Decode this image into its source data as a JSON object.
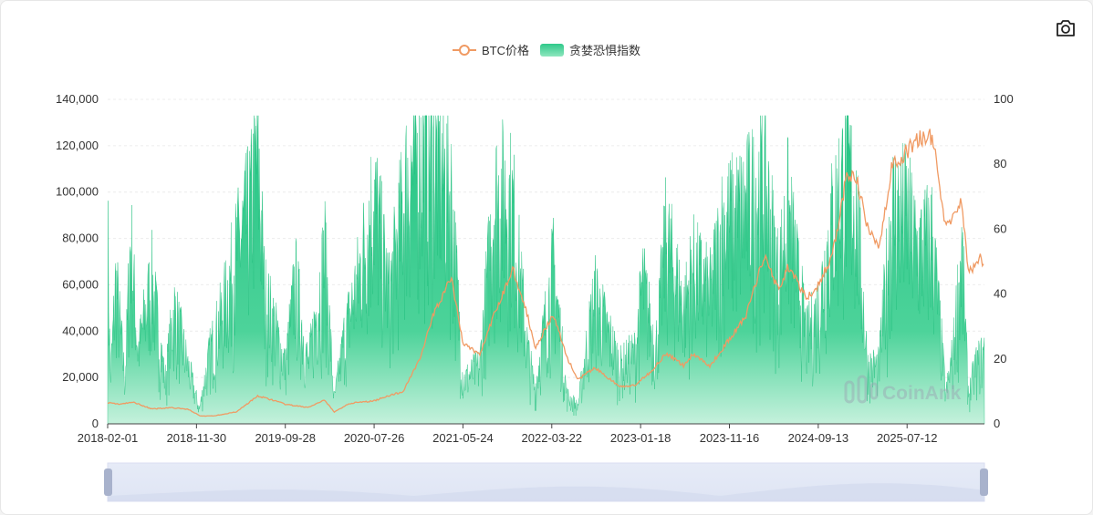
{
  "toolbar": {
    "camera_icon": "camera-icon"
  },
  "legend": {
    "btc": {
      "label": "BTC价格",
      "color": "#f09a63"
    },
    "fear": {
      "label": "贪婪恐惧指数",
      "color": "#2fc98a"
    }
  },
  "watermark": {
    "text": "CoinAnk"
  },
  "chart_data": {
    "type": "line",
    "x_axis": {
      "type": "date",
      "range": [
        "2018-02-01",
        "2026-04-01"
      ],
      "tick_labels": [
        "2018-02-01",
        "2018-11-30",
        "2019-09-28",
        "2020-07-26",
        "2021-05-24",
        "2022-03-22",
        "2023-01-18",
        "2023-11-16",
        "2024-09-13",
        "2025-07-12"
      ]
    },
    "y_axis_left": {
      "range": [
        0,
        140000
      ],
      "ticks": [
        0,
        20000,
        40000,
        60000,
        80000,
        100000,
        120000,
        140000
      ],
      "tick_labels": [
        "0",
        "20,000",
        "40,000",
        "60,000",
        "80,000",
        "100,000",
        "120,000",
        "140,000"
      ]
    },
    "y_axis_right": {
      "range": [
        0,
        100
      ],
      "ticks": [
        0,
        20,
        40,
        60,
        80,
        100
      ],
      "tick_labels": [
        "0",
        "20",
        "40",
        "60",
        "80",
        "100"
      ]
    },
    "grid": "horizontal",
    "legend_position": "top-center",
    "series": [
      {
        "name": "BTC价格",
        "type": "line",
        "axis": "left",
        "color": "#f09a63",
        "points": [
          [
            "2018-02-01",
            9200
          ],
          [
            "2018-03-15",
            8500
          ],
          [
            "2018-05-01",
            9300
          ],
          [
            "2018-07-01",
            6400
          ],
          [
            "2018-09-01",
            7000
          ],
          [
            "2018-11-01",
            6300
          ],
          [
            "2018-12-15",
            3300
          ],
          [
            "2019-02-01",
            3500
          ],
          [
            "2019-04-15",
            5200
          ],
          [
            "2019-06-26",
            12000
          ],
          [
            "2019-08-15",
            10300
          ],
          [
            "2019-10-01",
            8300
          ],
          [
            "2019-12-15",
            7100
          ],
          [
            "2020-02-10",
            10200
          ],
          [
            "2020-03-12",
            5000
          ],
          [
            "2020-05-01",
            8800
          ],
          [
            "2020-07-26",
            9900
          ],
          [
            "2020-09-01",
            11700
          ],
          [
            "2020-11-01",
            13800
          ],
          [
            "2020-12-31",
            29000
          ],
          [
            "2021-02-15",
            48000
          ],
          [
            "2021-04-14",
            63000
          ],
          [
            "2021-05-24",
            35000
          ],
          [
            "2021-07-20",
            29800
          ],
          [
            "2021-09-07",
            46900
          ],
          [
            "2021-11-10",
            67000
          ],
          [
            "2021-12-31",
            46200
          ],
          [
            "2022-01-24",
            33000
          ],
          [
            "2022-03-28",
            47000
          ],
          [
            "2022-05-12",
            29000
          ],
          [
            "2022-06-18",
            19000
          ],
          [
            "2022-08-15",
            24200
          ],
          [
            "2022-11-09",
            16000
          ],
          [
            "2022-12-31",
            16500
          ],
          [
            "2023-03-01",
            23500
          ],
          [
            "2023-04-14",
            30500
          ],
          [
            "2023-06-15",
            25000
          ],
          [
            "2023-07-15",
            30300
          ],
          [
            "2023-09-11",
            25000
          ],
          [
            "2023-11-16",
            36500
          ],
          [
            "2024-01-11",
            46500
          ],
          [
            "2024-03-14",
            73000
          ],
          [
            "2024-05-01",
            57500
          ],
          [
            "2024-06-01",
            68000
          ],
          [
            "2024-08-05",
            54000
          ],
          [
            "2024-09-13",
            60000
          ],
          [
            "2024-10-30",
            72000
          ],
          [
            "2024-12-17",
            106000
          ],
          [
            "2025-01-21",
            106000
          ],
          [
            "2025-02-28",
            84000
          ],
          [
            "2025-04-07",
            76000
          ],
          [
            "2025-05-22",
            111000
          ],
          [
            "2025-07-12",
            117500
          ],
          [
            "2025-08-14",
            123000
          ],
          [
            "2025-10-06",
            124000
          ],
          [
            "2025-11-21",
            84000
          ],
          [
            "2025-12-15",
            89000
          ],
          [
            "2026-01-14",
            97000
          ],
          [
            "2026-02-06",
            65000
          ],
          [
            "2026-03-01",
            68000
          ],
          [
            "2026-03-20",
            72000
          ],
          [
            "2026-04-01",
            68000
          ]
        ]
      },
      {
        "name": "贪婪恐惧指数",
        "type": "area",
        "axis": "right",
        "color": "#2fc98a",
        "points": [
          [
            "2018-02-01",
            70
          ],
          [
            "2018-02-10",
            15
          ],
          [
            "2018-03-01",
            50
          ],
          [
            "2018-04-01",
            15
          ],
          [
            "2018-04-20",
            65
          ],
          [
            "2018-05-15",
            25
          ],
          [
            "2018-07-01",
            50
          ],
          [
            "2018-08-15",
            15
          ],
          [
            "2018-09-15",
            40
          ],
          [
            "2018-11-01",
            20
          ],
          [
            "2018-12-10",
            5
          ],
          [
            "2019-01-15",
            25
          ],
          [
            "2019-03-01",
            40
          ],
          [
            "2019-04-15",
            60
          ],
          [
            "2019-06-01",
            75
          ],
          [
            "2019-06-26",
            95
          ],
          [
            "2019-07-20",
            45
          ],
          [
            "2019-08-20",
            35
          ],
          [
            "2019-09-28",
            20
          ],
          [
            "2019-11-01",
            50
          ],
          [
            "2019-12-15",
            20
          ],
          [
            "2020-02-10",
            60
          ],
          [
            "2020-03-12",
            8
          ],
          [
            "2020-04-15",
            30
          ],
          [
            "2020-06-01",
            50
          ],
          [
            "2020-07-26",
            80
          ],
          [
            "2020-09-15",
            45
          ],
          [
            "2020-11-15",
            85
          ],
          [
            "2020-12-31",
            95
          ],
          [
            "2021-02-15",
            95
          ],
          [
            "2021-04-14",
            80
          ],
          [
            "2021-05-24",
            15
          ],
          [
            "2021-07-20",
            20
          ],
          [
            "2021-09-07",
            78
          ],
          [
            "2021-10-20",
            80
          ],
          [
            "2021-11-10",
            75
          ],
          [
            "2021-12-31",
            25
          ],
          [
            "2022-01-24",
            12
          ],
          [
            "2022-03-28",
            55
          ],
          [
            "2022-05-12",
            10
          ],
          [
            "2022-06-18",
            6
          ],
          [
            "2022-08-15",
            45
          ],
          [
            "2022-11-09",
            20
          ],
          [
            "2022-12-31",
            25
          ],
          [
            "2023-01-25",
            50
          ],
          [
            "2023-03-10",
            25
          ],
          [
            "2023-04-14",
            65
          ],
          [
            "2023-06-15",
            40
          ],
          [
            "2023-07-15",
            55
          ],
          [
            "2023-09-11",
            45
          ],
          [
            "2023-10-25",
            70
          ],
          [
            "2023-11-16",
            70
          ],
          [
            "2024-01-11",
            75
          ],
          [
            "2024-03-14",
            85
          ],
          [
            "2024-05-01",
            50
          ],
          [
            "2024-06-01",
            75
          ],
          [
            "2024-08-05",
            30
          ],
          [
            "2024-09-13",
            40
          ],
          [
            "2024-10-30",
            70
          ],
          [
            "2024-12-17",
            90
          ],
          [
            "2025-01-21",
            75
          ],
          [
            "2025-02-28",
            20
          ],
          [
            "2025-04-07",
            20
          ],
          [
            "2025-05-22",
            75
          ],
          [
            "2025-07-12",
            73
          ],
          [
            "2025-08-14",
            60
          ],
          [
            "2025-10-06",
            65
          ],
          [
            "2025-11-21",
            10
          ],
          [
            "2025-12-15",
            25
          ],
          [
            "2026-01-14",
            60
          ],
          [
            "2026-02-06",
            10
          ],
          [
            "2026-03-01",
            20
          ],
          [
            "2026-04-01",
            25
          ]
        ]
      }
    ],
    "data_zoom": {
      "start": 0,
      "end": 1
    }
  }
}
